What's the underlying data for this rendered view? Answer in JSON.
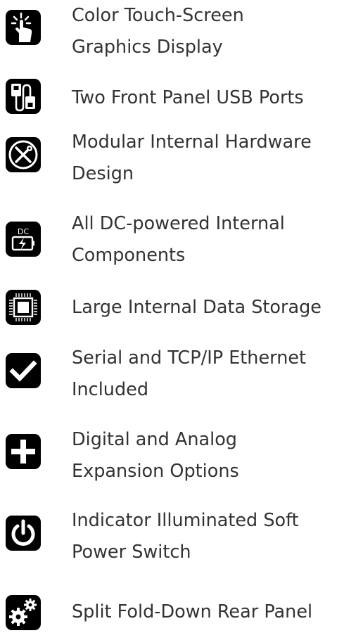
{
  "features": [
    {
      "icon": "touch-screen-icon",
      "lines": [
        "Color Touch-Screen",
        "Graphics Display"
      ]
    },
    {
      "icon": "usb-ports-icon",
      "lines": [
        "Two Front Panel USB Ports"
      ]
    },
    {
      "icon": "tools-icon",
      "lines": [
        "Modular Internal Hardware",
        "Design"
      ]
    },
    {
      "icon": "dc-power-icon",
      "icon_text": "DC",
      "lines": [
        "All DC-powered Internal",
        "Components"
      ]
    },
    {
      "icon": "chip-icon",
      "lines": [
        "Large Internal Data Storage"
      ]
    },
    {
      "icon": "checkmark-icon",
      "lines": [
        "Serial and TCP/IP Ethernet",
        "Included"
      ]
    },
    {
      "icon": "plus-icon",
      "lines": [
        "Digital and Analog",
        "Expansion Options"
      ]
    },
    {
      "icon": "power-icon",
      "lines": [
        "Indicator Illuminated Soft",
        "Power Switch"
      ]
    },
    {
      "icon": "gears-icon",
      "lines": [
        "Split Fold-Down Rear Panel"
      ]
    }
  ],
  "colors": {
    "icon_background": "#000000",
    "text": "#333333"
  }
}
